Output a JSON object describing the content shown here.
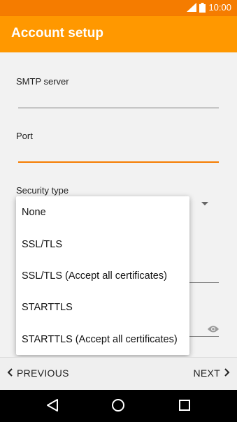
{
  "status_bar": {
    "time": "10:00",
    "icons": [
      "signal-icon",
      "battery-icon"
    ]
  },
  "app_bar": {
    "title": "Account setup",
    "color": "#ff9800",
    "status_color": "#f57c00"
  },
  "form": {
    "smtp_server_label": "SMTP server",
    "smtp_server_value": "",
    "port_label": "Port",
    "port_value": "",
    "security_type_label": "Security type"
  },
  "security_menu": {
    "options": [
      "None",
      "SSL/TLS",
      "SSL/TLS (Accept all certificates)",
      "STARTTLS",
      "STARTTLS (Accept all certificates)"
    ]
  },
  "bottom_bar": {
    "previous_label": "PREVIOUS",
    "next_label": "NEXT"
  },
  "system_nav": {
    "icons": [
      "back-icon",
      "home-icon",
      "recents-icon"
    ]
  },
  "accent_color": "#f57c00"
}
